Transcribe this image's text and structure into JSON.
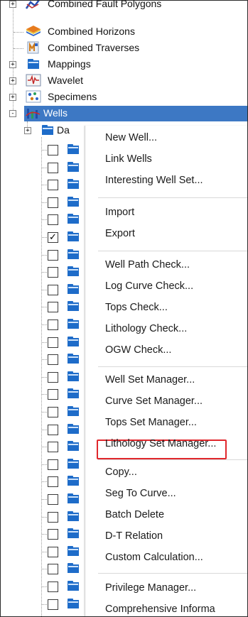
{
  "tree": {
    "items": [
      {
        "label": "Combined Fault Polygons",
        "icon": "fault-polygons-icon",
        "expander": "+"
      },
      {
        "label": "Combined Horizons",
        "icon": "horizons-icon",
        "expander": ""
      },
      {
        "label": "Combined Traverses",
        "icon": "traverses-icon",
        "expander": ""
      },
      {
        "label": "Mappings",
        "icon": "folder-icon",
        "expander": "+"
      },
      {
        "label": "Wavelet",
        "icon": "wavelet-icon",
        "expander": "+"
      },
      {
        "label": "Specimens",
        "icon": "specimens-icon",
        "expander": "+"
      },
      {
        "label": "Wells",
        "icon": "wells-icon",
        "expander": "-"
      }
    ],
    "child_folder_label": "Da",
    "child_folder_expander": "+",
    "check_mark": "✓",
    "well_checked": [
      false,
      false,
      false,
      false,
      false,
      true,
      false,
      false,
      false,
      false,
      false,
      false,
      false,
      false,
      false,
      false,
      false,
      false,
      false,
      false,
      false,
      false,
      false,
      false,
      false,
      false,
      false
    ]
  },
  "context_menu": {
    "groups": [
      [
        "New Well...",
        "Link Wells",
        "Interesting Well Set..."
      ],
      [
        "Import",
        "Export"
      ],
      [
        "Well Path Check...",
        "Log Curve Check...",
        "Tops Check...",
        "Lithology Check...",
        "OGW Check..."
      ],
      [
        "Well Set Manager...",
        "Curve Set Manager...",
        "Tops Set Manager...",
        "Lithology Set Manager..."
      ],
      [
        "Copy...",
        "Seg To Curve...",
        "Batch Delete",
        "D-T Relation",
        "Custom Calculation..."
      ],
      [
        "Privilege Manager...",
        "Comprehensive Informa"
      ]
    ],
    "highlighted_item": "Seg To Curve...",
    "highlight_color": "#e0272c"
  },
  "colors": {
    "selection": "#3d78c4",
    "folder": "#1e6cc9"
  }
}
